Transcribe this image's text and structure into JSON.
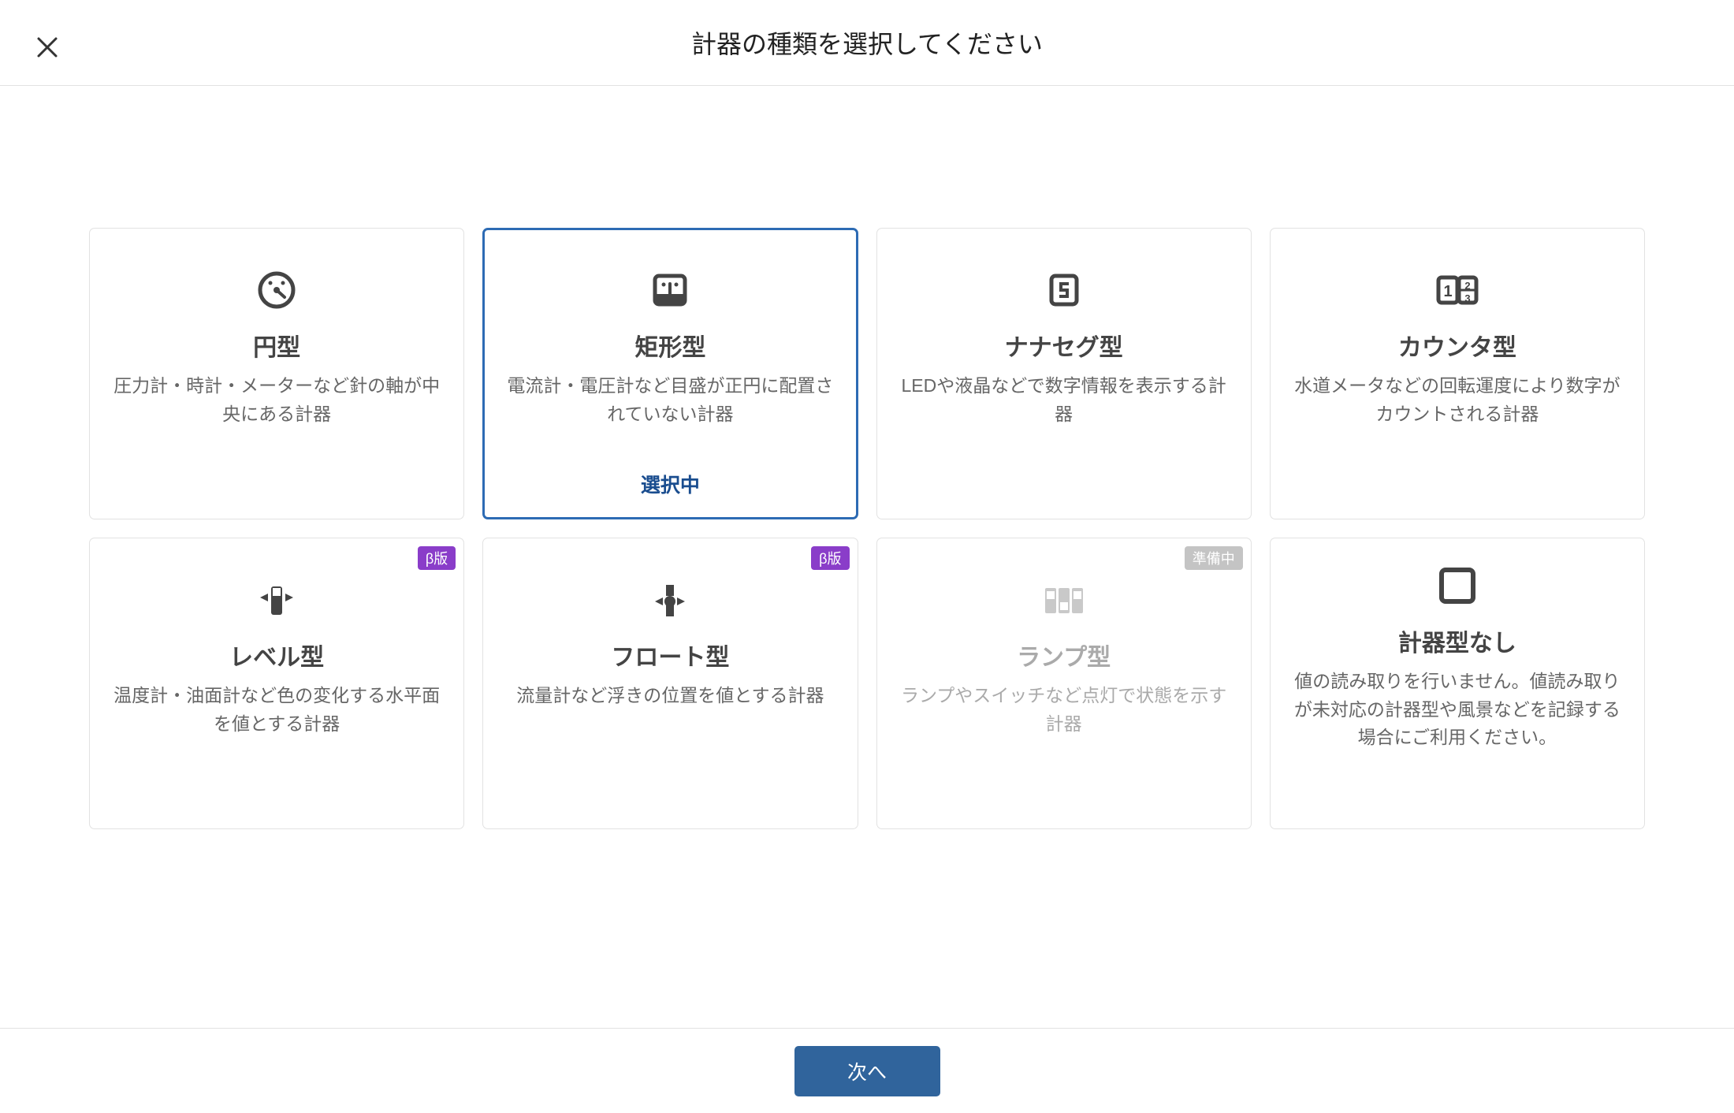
{
  "header": {
    "title": "計器の種類を選択してください"
  },
  "cards": {
    "circular": {
      "title": "円型",
      "desc": "圧力計・時計・メーターなど針の軸が中央にある計器"
    },
    "rect": {
      "title": "矩形型",
      "desc": "電流計・電圧計など目盛が正円に配置されていない計器",
      "selected_label": "選択中"
    },
    "sevenseg": {
      "title": "ナナセグ型",
      "desc": "LEDや液晶などで数字情報を表示する計器"
    },
    "counter": {
      "title": "カウンタ型",
      "desc": "水道メータなどの回転運度により数字がカウントされる計器"
    },
    "level": {
      "title": "レベル型",
      "desc": "温度計・油面計など色の変化する水平面を値とする計器",
      "badge": "β版"
    },
    "float": {
      "title": "フロート型",
      "desc": "流量計など浮きの位置を値とする計器",
      "badge": "β版"
    },
    "lamp": {
      "title": "ランプ型",
      "desc": "ランプやスイッチなど点灯で状態を示す計器",
      "badge": "準備中"
    },
    "none": {
      "title": "計器型なし",
      "desc": "値の読み取りを行いません。値読み取りが未対応の計器型や風景などを記録する場合にご利用ください。"
    }
  },
  "footer": {
    "next_label": "次へ"
  }
}
